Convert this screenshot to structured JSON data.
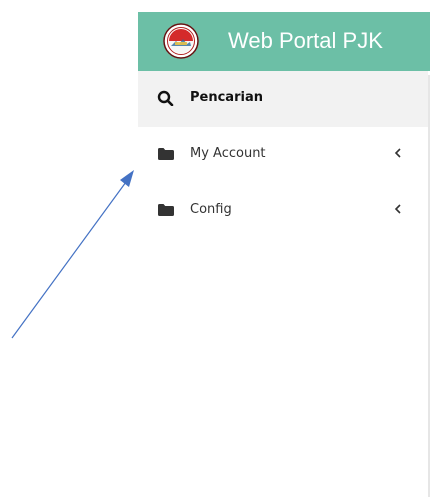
{
  "brand": {
    "title": "Web Portal PJK",
    "logo_icon": "emblem-logo",
    "bar_color": "#6cbfa6"
  },
  "menu": {
    "items": [
      {
        "label": "Pencarian",
        "icon": "search-icon",
        "has_chevron": false
      },
      {
        "label": "My Account",
        "icon": "folder-icon",
        "has_chevron": true
      },
      {
        "label": "Config",
        "icon": "folder-icon",
        "has_chevron": true
      }
    ]
  },
  "annotation": {
    "arrow_color": "#4472c4",
    "description_icon": "annotation-arrow"
  }
}
